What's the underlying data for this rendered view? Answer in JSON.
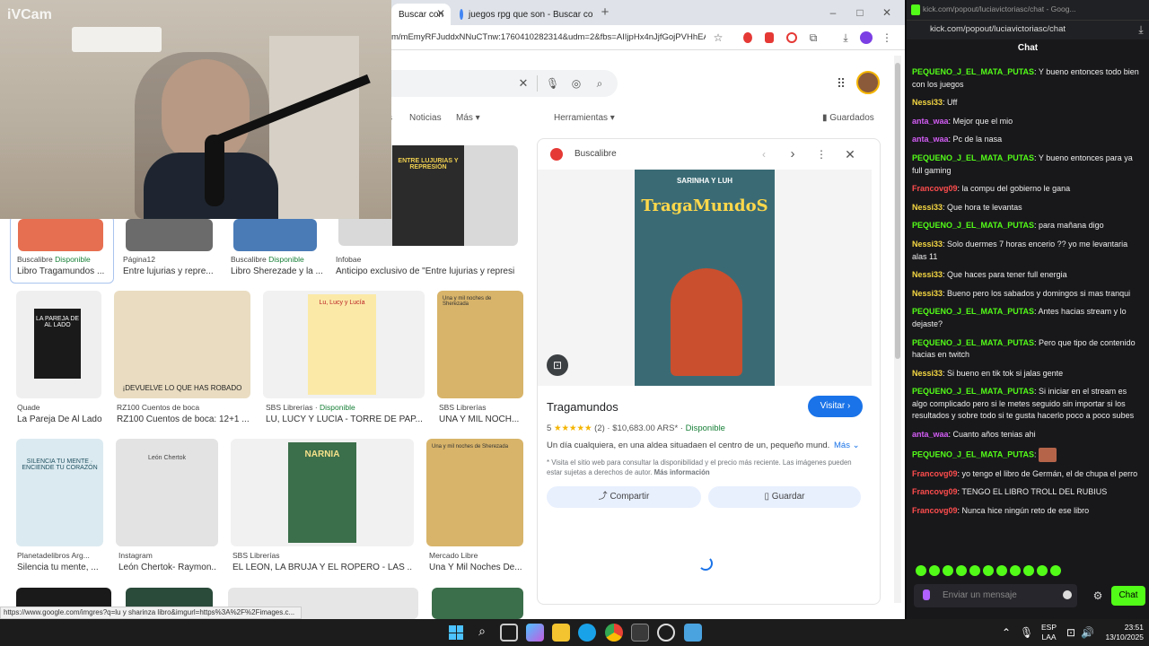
{
  "webcam": {
    "logo": "iVCam"
  },
  "browser": {
    "tabs": [
      {
        "label": "Buscar con"
      },
      {
        "label": "juegos rpg que son - Buscar co"
      }
    ],
    "new_tab": "+",
    "window_controls": {
      "minimize": "–",
      "maximize": "□",
      "close": "✕"
    },
    "url": "m/mEmyRFJuddxNNuCTnw:1760410282314&udm=2&fbs=AIIjpHx4nJjfGojPVHhEA...",
    "status_url": "https://www.google.com/imgres?q=lu y sharinza libro&imgurl=https%3A%2F%2Fimages.c..."
  },
  "google": {
    "nav": {
      "n0": "s",
      "noticias": "Noticias",
      "mas": "Más ▾",
      "herramientas": "Herramientas ▾",
      "guardados": "Guardados"
    },
    "row1": [
      {
        "source": "Buscalibre",
        "avail": "Disponible",
        "title": "Libro Tragamundos ..."
      },
      {
        "source": "Página12",
        "avail": "",
        "title": "Entre lujurias y repre..."
      },
      {
        "source": "Buscalibre",
        "avail": "Disponible",
        "title": "Libro Sherezade y la ..."
      },
      {
        "source": "Infobae",
        "avail": "",
        "title": "Anticipo exclusivo de \"Entre lujurias y represi..."
      }
    ],
    "row2": [
      {
        "source": "Quade",
        "avail": "",
        "title": "La Pareja De Al Lado",
        "thumb": "LA PAREJA DE AL LADO"
      },
      {
        "source": "RZ100 Cuentos de boca",
        "avail": "",
        "title": "RZ100 Cuentos de boca: 12+1 ...",
        "thumb": "¡DEVUELVE LO QUE HAS ROBADO"
      },
      {
        "source": "SBS Librerías",
        "avail": "Disponible",
        "title": "LU, LUCY Y LUCÍA - TORRE DE PAP...",
        "thumb": "Lu, Lucy y Lucía"
      },
      {
        "source": "SBS Librerías",
        "avail": "",
        "title": "UNA Y MIL NOCH...",
        "thumb": "Una y mil noches de Sherezada"
      }
    ],
    "row3": [
      {
        "source": "Planetadelibros Arg...",
        "avail": "",
        "title": "Silencia tu mente, ...",
        "thumb": "SILENCIA TU MENTE · ENCIENDE TU CORAZÓN"
      },
      {
        "source": "Instagram",
        "avail": "",
        "title": "León Chertok- Raymon...",
        "thumb": "León Chertok"
      },
      {
        "source": "SBS Librerías",
        "avail": "",
        "title": "EL LEON, LA BRUJA Y EL ROPERO - LAS ...",
        "thumb": "NARNIA"
      },
      {
        "source": "Mercado Libre",
        "avail": "",
        "title": "Una Y Mil Noches De...",
        "thumb": "Una y mil noches de Sherezada"
      }
    ],
    "featured_book": {
      "title": "ENTRE LUJURIAS Y REPRESIÓN"
    },
    "panel": {
      "source": "Buscalibre",
      "cover_top": "SARINHA Y LUH",
      "cover_title": "TragaMundoS",
      "title": "Tragamundos",
      "rating_num": "5",
      "stars": "★★★★★",
      "reviews": "(2)",
      "price": "$10,683.00 ARS*",
      "availability": "Disponible",
      "visit": "Visitar ›",
      "description": "Un día cualquiera, en una aldea situadaen el centro de un, pequeño mund...",
      "more": "Más ⌄",
      "disclaimer": "* Visita el sitio web para consultar la disponibilidad y el precio más reciente. Las imágenes pueden estar sujetas a derechos de autor.",
      "more_info": "Más información",
      "share": "Compartir",
      "save": "Guardar"
    }
  },
  "kick": {
    "url": "kick.com/popout/luciavictoriasc/chat - Goog...",
    "url2": "kick.com/popout/luciavictoriasc/chat",
    "header": "Chat",
    "messages": [
      {
        "user": "PEQUENO_J_EL_MATA_PUTAS",
        "color": "#53fc18",
        "text": "Y bueno entonces todo bien con los juegos"
      },
      {
        "user": "Nessi33",
        "color": "#f5d742",
        "text": "Uff"
      },
      {
        "user": "anta_waa",
        "color": "#d45df5",
        "text": "Mejor que el mio"
      },
      {
        "user": "anta_waa",
        "color": "#d45df5",
        "text": "Pc de la nasa"
      },
      {
        "user": "PEQUENO_J_EL_MATA_PUTAS",
        "color": "#53fc18",
        "text": "Y bueno entonces para ya full gaming"
      },
      {
        "user": "Francovg09",
        "color": "#ff4d4d",
        "text": "la compu del gobierno le gana"
      },
      {
        "user": "Nessi33",
        "color": "#f5d742",
        "text": "Que hora te levantas"
      },
      {
        "user": "PEQUENO_J_EL_MATA_PUTAS",
        "color": "#53fc18",
        "text": "para mañana digo"
      },
      {
        "user": "Nessi33",
        "color": "#f5d742",
        "text": "Solo duermes 7 horas encerio ?? yo me levantaria alas 11"
      },
      {
        "user": "Nessi33",
        "color": "#f5d742",
        "text": "Que haces para tener full energia"
      },
      {
        "user": "Nessi33",
        "color": "#f5d742",
        "text": "Bueno pero los sabados y domingos si mas tranqui"
      },
      {
        "user": "PEQUENO_J_EL_MATA_PUTAS",
        "color": "#53fc18",
        "text": "Antes hacias stream y lo dejaste?"
      },
      {
        "user": "PEQUENO_J_EL_MATA_PUTAS",
        "color": "#53fc18",
        "text": "Pero que tipo de contenido hacias en twitch"
      },
      {
        "user": "Nessi33",
        "color": "#f5d742",
        "text": "Si bueno en tik tok si jalas gente"
      },
      {
        "user": "PEQUENO_J_EL_MATA_PUTAS",
        "color": "#53fc18",
        "text": "Si iniciar en el stream es algo complicado pero si le metes seguido sin importar si los resultados y sobre todo si te gusta hacerlo poco a poco subes"
      },
      {
        "user": "anta_waa",
        "color": "#d45df5",
        "text": "Cuanto años tenias ahi"
      },
      {
        "user": "PEQUENO_J_EL_MATA_PUTAS",
        "color": "#53fc18",
        "text": ""
      },
      {
        "user": "Francovg09",
        "color": "#ff4d4d",
        "text": "yo tengo el libro de Germán, el de chupa el perro"
      },
      {
        "user": "Francovg09",
        "color": "#ff4d4d",
        "text": "TENGO EL LIBRO TROLL DEL RUBIUS"
      },
      {
        "user": "Francovg09",
        "color": "#ff4d4d",
        "text": "Nunca hice ningún reto de ese libro"
      }
    ],
    "input_placeholder": "Enviar un mensaje",
    "chat_button": "Chat"
  },
  "taskbar": {
    "lang1": "ESP",
    "lang2": "LAA",
    "time": "23:51",
    "date": "13/10/2025"
  }
}
